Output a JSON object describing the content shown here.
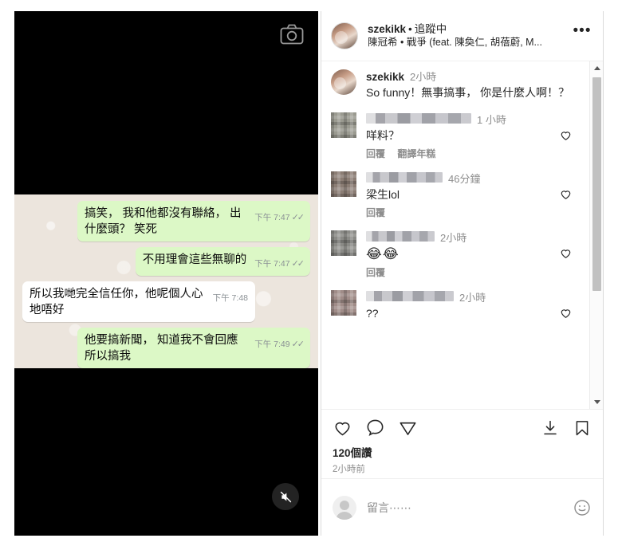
{
  "media": {
    "camera_icon": "camera-icon",
    "mute_icon": "mute-speaker-icon",
    "chat": {
      "app": "whatsapp-chat-screenshot",
      "messages": [
        {
          "direction": "out",
          "text": "搞笑， 我和他都沒有聯絡， 出什麼頭？ 笑死",
          "time": "下午 7:47",
          "ticks": "✓✓"
        },
        {
          "direction": "out",
          "text": "不用理會這些無聊的",
          "time": "下午 7:47",
          "ticks": "✓✓"
        },
        {
          "direction": "in",
          "text": "所以我哋完全信任你，他呢個人心地唔好",
          "time": "下午 7:48",
          "ticks": ""
        },
        {
          "direction": "out",
          "text": "他要搞新聞， 知道我不會回應所以搞我",
          "time": "下午 7:49",
          "ticks": "✓✓"
        }
      ]
    }
  },
  "post": {
    "header": {
      "username": "szekikk",
      "separator": "•",
      "follow_state": "追蹤中",
      "audio": "陳冠希 • 戰爭 (feat. 陳奐仁, 胡蓓蔚, M...",
      "more_label": "•••"
    },
    "comments": [
      {
        "avatar": "owner",
        "username": "szekikk",
        "username_redacted": false,
        "time": "2小時",
        "text": "So funny！無事搞事， 你是什麼人啊！？",
        "actions": [],
        "liked": false,
        "has_like_button": false
      },
      {
        "avatar": "blurred",
        "username": "",
        "username_redacted": true,
        "redact_width": 132,
        "time": "1 小時",
        "text": "咩料？",
        "actions": [
          "回覆",
          "翻譯年糕"
        ],
        "liked": false,
        "has_like_button": true
      },
      {
        "avatar": "blurred",
        "username": "",
        "username_redacted": true,
        "redact_width": 96,
        "time": "46分鐘",
        "text": "梁生lol",
        "actions": [
          "回覆"
        ],
        "liked": false,
        "has_like_button": true
      },
      {
        "avatar": "blurred",
        "username": "",
        "username_redacted": true,
        "redact_width": 86,
        "time": "2小時",
        "text": "😂😂",
        "actions": [
          "回覆"
        ],
        "liked": false,
        "has_like_button": true
      },
      {
        "avatar": "blurred",
        "username": "",
        "username_redacted": true,
        "redact_width": 110,
        "time": "2小時",
        "text": "??",
        "actions": [],
        "liked": false,
        "has_like_button": true
      }
    ],
    "scrollbar": {
      "up_arrow": "▲",
      "down_arrow": "▼",
      "thumb_top_pct": 5,
      "thumb_height_pct": 66
    },
    "actions": {
      "like_icon": "heart-icon",
      "comment_icon": "comment-icon",
      "share_icon": "share-paper-plane-icon",
      "download_icon": "download-icon",
      "save_icon": "bookmark-icon"
    },
    "likes_text": "120個讚",
    "posted_time": "2小時前",
    "add_comment": {
      "placeholder": "留言⋯⋯",
      "value": "",
      "emoji_icon": "emoji-smiley-icon",
      "avatar": "default-avatar"
    }
  },
  "colors": {
    "bubble_out": "#dcf8c6",
    "bubble_in": "#ffffff",
    "chat_bg": "#ece5dd",
    "text_primary": "#262626",
    "text_secondary": "#8e8e8e",
    "border": "#dbdbdb"
  }
}
